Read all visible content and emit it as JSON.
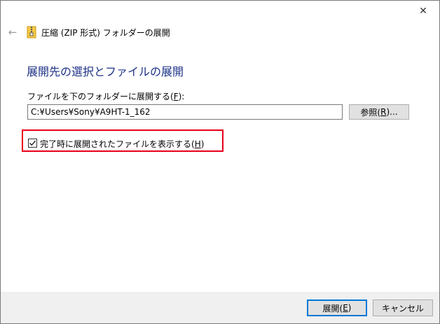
{
  "window": {
    "title": "圧縮 (ZIP 形式) フォルダーの展開",
    "close_glyph": "✕",
    "back_glyph": "←"
  },
  "heading": "展開先の選択とファイルの展開",
  "destination": {
    "label_pre": "ファイルを下のフォルダーに展開する(",
    "label_key": "F",
    "label_post": "):",
    "value": "C:¥Users¥Sony¥A9HT-1_162"
  },
  "browse_button": {
    "label_pre": "参照(",
    "label_key": "R",
    "label_post": ")..."
  },
  "show_files_checkbox": {
    "checked": true,
    "label_pre": "完了時に展開されたファイルを表示する(",
    "label_key": "H",
    "label_post": ")"
  },
  "footer": {
    "extract_button": {
      "label_pre": "展開(",
      "label_key": "E",
      "label_post": ")"
    },
    "cancel_button": "キャンセル"
  },
  "colors": {
    "heading": "#1e3287",
    "highlight_border": "#e8001c",
    "default_button_border": "#0078d7",
    "footer_bg": "#f0f0f0"
  },
  "icons": {
    "back": "back-arrow-icon",
    "zip": "zip-folder-icon",
    "close": "close-icon",
    "check": "checkmark-icon"
  }
}
